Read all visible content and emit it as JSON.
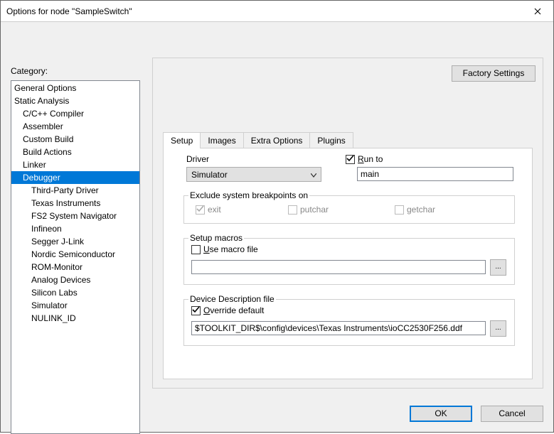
{
  "window": {
    "title": "Options for node \"SampleSwitch\""
  },
  "category": {
    "label": "Category:",
    "items": [
      {
        "label": "General Options",
        "indent": 0
      },
      {
        "label": "Static Analysis",
        "indent": 0
      },
      {
        "label": "C/C++ Compiler",
        "indent": 1
      },
      {
        "label": "Assembler",
        "indent": 1
      },
      {
        "label": "Custom Build",
        "indent": 1
      },
      {
        "label": "Build Actions",
        "indent": 1
      },
      {
        "label": "Linker",
        "indent": 1
      },
      {
        "label": "Debugger",
        "indent": 1,
        "selected": true
      },
      {
        "label": "Third-Party Driver",
        "indent": 2
      },
      {
        "label": "Texas Instruments",
        "indent": 2
      },
      {
        "label": "FS2 System Navigator",
        "indent": 2
      },
      {
        "label": "Infineon",
        "indent": 2
      },
      {
        "label": "Segger J-Link",
        "indent": 2
      },
      {
        "label": "Nordic Semiconductor",
        "indent": 2
      },
      {
        "label": "ROM-Monitor",
        "indent": 2
      },
      {
        "label": "Analog Devices",
        "indent": 2
      },
      {
        "label": "Silicon Labs",
        "indent": 2
      },
      {
        "label": "Simulator",
        "indent": 2
      },
      {
        "label": "NULINK_ID",
        "indent": 2
      }
    ]
  },
  "factory_button": "Factory Settings",
  "tabs": [
    "Setup",
    "Images",
    "Extra Options",
    "Plugins"
  ],
  "active_tab": 0,
  "setup": {
    "driver_label": "Driver",
    "driver_value": "Simulator",
    "run_to_label": "Run to",
    "run_to_checked": true,
    "run_to_value": "main",
    "exclude_label": "Exclude system breakpoints on",
    "bp_exit": {
      "label": "exit",
      "checked": true,
      "disabled": true
    },
    "bp_putchar": {
      "label": "putchar",
      "checked": false,
      "disabled": true
    },
    "bp_getchar": {
      "label": "getchar",
      "checked": false,
      "disabled": true
    },
    "macros_label": "Setup macros",
    "use_macro_label": "Use macro file",
    "use_macro_checked": false,
    "macro_path": "",
    "ddf_label": "Device Description file",
    "override_label": "Override default",
    "override_checked": true,
    "ddf_path": "$TOOLKIT_DIR$\\config\\devices\\Texas Instruments\\ioCC2530F256.ddf",
    "browse_label": "..."
  },
  "buttons": {
    "ok": "OK",
    "cancel": "Cancel"
  }
}
